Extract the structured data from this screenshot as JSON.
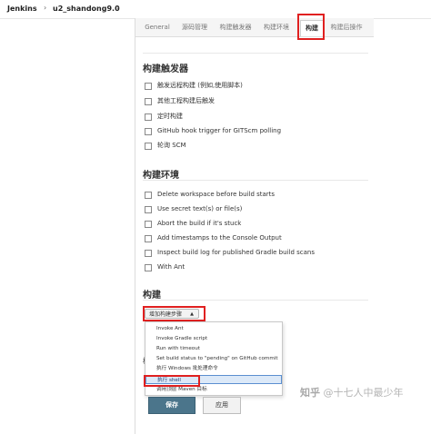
{
  "breadcrumb": {
    "root": "Jenkins",
    "job": "u2_shandong9.0",
    "separator": "›"
  },
  "tabs": [
    {
      "label": "General",
      "active": false
    },
    {
      "label": "源码管理",
      "active": false
    },
    {
      "label": "构建触发器",
      "active": false
    },
    {
      "label": "构建环境",
      "active": false
    },
    {
      "label": "构建",
      "active": true
    },
    {
      "label": "构建后操作",
      "active": false
    }
  ],
  "triggers": {
    "title": "构建触发器",
    "options": [
      "触发远程构建 (例如,使用脚本)",
      "其他工程构建后触发",
      "定时构建",
      "GitHub hook trigger for GITScm polling",
      "轮询 SCM"
    ]
  },
  "environment": {
    "title": "构建环境",
    "options": [
      "Delete workspace before build starts",
      "Use secret text(s) or file(s)",
      "Abort the build if it's stuck",
      "Add timestamps to the Console Output",
      "Inspect build log for published Gradle build scans",
      "With Ant"
    ]
  },
  "build": {
    "title": "构建",
    "add_step_label": "增加构建步骤",
    "dropdown_items": [
      "Invoke Ant",
      "Invoke Gradle script",
      "Run with timeout",
      "Set build status to \"pending\" on GitHub commit",
      "执行 Windows 批处理命令",
      "执行 shell",
      "调用顶层 Maven 目标"
    ],
    "selected_index": 5
  },
  "buttons": {
    "save": "保存",
    "apply": "应用"
  },
  "watermark": {
    "logo": "知乎",
    "text": "@十七人中最少年"
  },
  "colors": {
    "highlight": "#e02020",
    "save_button": "#4b758b",
    "selected_item": "#dce9f8"
  }
}
